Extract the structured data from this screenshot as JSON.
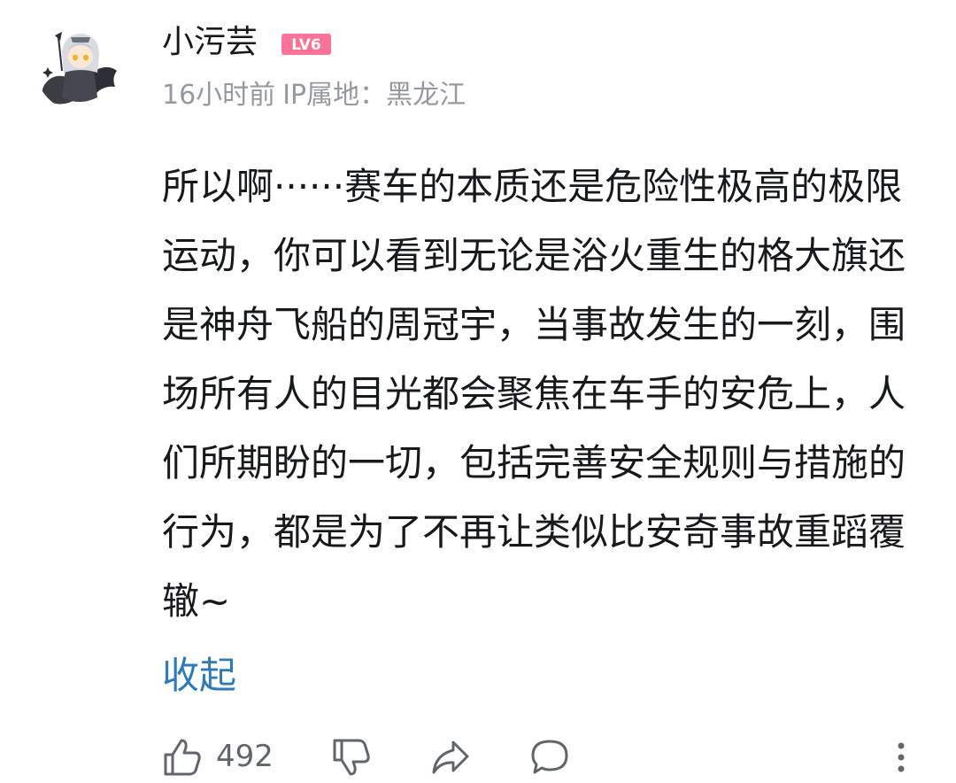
{
  "user": {
    "name": "小污芸",
    "level": "LV6",
    "level_color": "#fb7299",
    "avatar": "avatar-anime-girl-with-dragon"
  },
  "meta": {
    "time": "16小时前",
    "ip_label": "IP属地：",
    "ip_location": "黑龙江"
  },
  "comment": {
    "text": "所以啊······赛车的本质还是危险性极高的极限运动，你可以看到无论是浴火重生的格大旗还是神舟飞船的周冠宇，当事故发生的一刻，围场所有人的目光都会聚焦在车手的安危上，人们所期盼的一切，包括完善安全规则与措施的行为，都是为了不再让类似比安奇事故重蹈覆辙~",
    "collapse_label": "收起"
  },
  "actions": {
    "like_icon": "thumbs-up-icon",
    "like_count": "492",
    "dislike_icon": "thumbs-down-icon",
    "share_icon": "share-arrow-icon",
    "reply_icon": "comment-bubble-icon",
    "more_icon": "vertical-dots-icon"
  },
  "colors": {
    "text": "#18191c",
    "meta": "#9499a0",
    "link": "#2f7ab8",
    "icon": "#61666d"
  }
}
